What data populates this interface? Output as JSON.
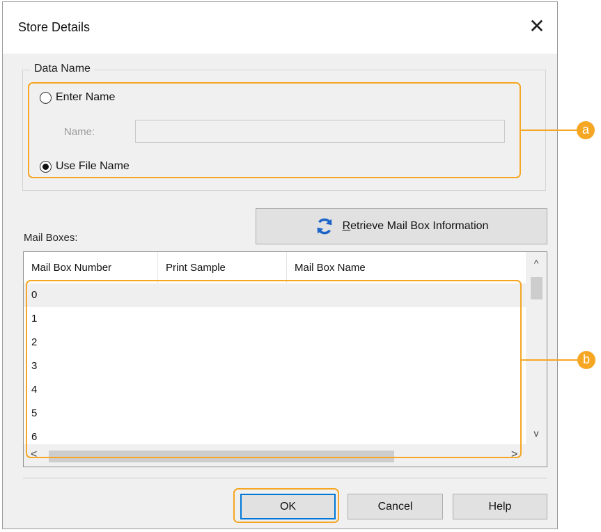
{
  "window": {
    "title": "Store Details",
    "close_glyph": "✕"
  },
  "data_name": {
    "legend": "Data Name",
    "enter_name_label": "Enter Name",
    "enter_name_selected": false,
    "name_field_label": "Name:",
    "name_field_value": "",
    "use_file_name_label": "Use File Name",
    "use_file_name_selected": true
  },
  "mail_boxes": {
    "label": "Mail Boxes:",
    "retrieve_button_label": "Retrieve Mail Box Information",
    "retrieve_button_mnemonic": "R",
    "columns": [
      "Mail Box Number",
      "Print Sample",
      "Mail Box Name"
    ],
    "rows": [
      "0",
      "1",
      "2",
      "3",
      "4",
      "5",
      "6"
    ],
    "selected_row": "0"
  },
  "buttons": {
    "ok": "OK",
    "cancel": "Cancel",
    "help": "Help"
  },
  "callouts": {
    "a": "a",
    "b": "b"
  },
  "icons": {
    "refresh": "refresh-icon",
    "close": "close-icon",
    "scroll_up": "^",
    "scroll_down": "v",
    "scroll_left": "<",
    "scroll_right": ">"
  },
  "colors": {
    "callout": "#f5a623",
    "refresh_icon": "#1e64c8",
    "default_button_border": "#0078d7"
  }
}
